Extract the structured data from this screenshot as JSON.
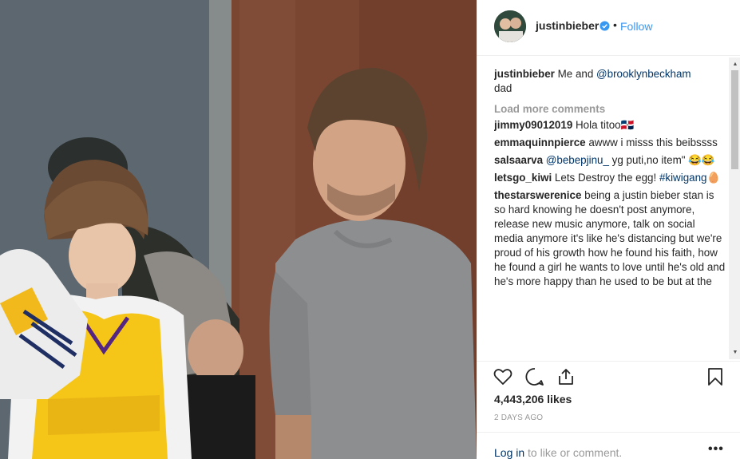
{
  "post": {
    "username": "justinbieber",
    "follow_label": "Follow",
    "separator": "•",
    "caption_text": "Me and ",
    "caption_mention": "@brooklynbeckham",
    "caption_rest": "dad"
  },
  "load_more": "Load more comments",
  "comments": [
    {
      "user": "jimmy09012019",
      "text": "Hola titoo🇩🇴"
    },
    {
      "user": "emmaquinnpierce",
      "text": "awww i misss this beibssss"
    },
    {
      "user": "salsaarva",
      "mention": "@bebepjinu_",
      "text": " yg puti,no item\" 😂😂"
    },
    {
      "user": "letsgo_kiwi",
      "text": "Lets Destroy the egg! ",
      "mention_after": "#kiwigang🥚"
    },
    {
      "user": "thestarswerenice",
      "text": "being a justin bieber stan is so hard knowing he doesn't post anymore, release new music anymore, talk on social media anymore it's like he's distancing but we're proud of his growth how he found his faith, how he found a girl he wants to love until he's old and he's more happy than he used to be but at the"
    }
  ],
  "likes": "4,443,206 likes",
  "time_ago": "2 DAYS AGO",
  "footer": {
    "login_link": "Log in",
    "login_rest": " to like or comment.",
    "more": "•••"
  },
  "icons": {
    "like": "heart-icon",
    "comment": "comment-icon",
    "share": "share-icon",
    "save": "bookmark-icon",
    "verified": "verified-badge-icon"
  },
  "colors": {
    "link_blue": "#3897f0",
    "mention_blue": "#003569",
    "muted": "#999999",
    "text": "#262626",
    "verified": "#3897f0"
  }
}
